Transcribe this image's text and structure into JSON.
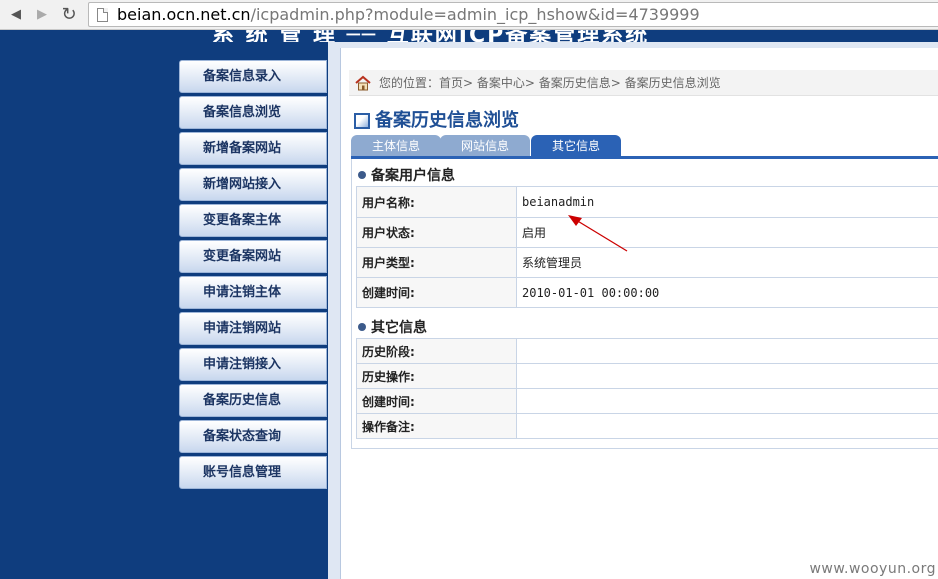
{
  "browser": {
    "url_host": "beian.ocn.net.cn",
    "url_path": "/icpadmin.php?module=admin_icp_hshow&id=4739999"
  },
  "header": {
    "title": "系 统 管 理 ── 互联网ICP备案管理系统"
  },
  "sidebar": {
    "items": [
      {
        "label": "备案信息录入"
      },
      {
        "label": "备案信息浏览"
      },
      {
        "label": "新增备案网站"
      },
      {
        "label": "新增网站接入"
      },
      {
        "label": "变更备案主体"
      },
      {
        "label": "变更备案网站"
      },
      {
        "label": "申请注销主体"
      },
      {
        "label": "申请注销网站"
      },
      {
        "label": "申请注销接入"
      },
      {
        "label": "备案历史信息"
      },
      {
        "label": "备案状态查询"
      },
      {
        "label": "账号信息管理"
      }
    ]
  },
  "breadcrumb": {
    "text": "您的位置：首页> 备案中心> 备案历史信息> 备案历史信息浏览"
  },
  "page": {
    "title": "备案历史信息浏览"
  },
  "tabs": [
    {
      "label": "主体信息"
    },
    {
      "label": "网站信息"
    },
    {
      "label": "其它信息"
    }
  ],
  "user_section": {
    "title": "备案用户信息",
    "rows": [
      {
        "label": "用户名称:",
        "value": "beianadmin"
      },
      {
        "label": "用户状态:",
        "value": "启用"
      },
      {
        "label": "用户类型:",
        "value": "系统管理员"
      },
      {
        "label": "创建时间:",
        "value": "2010-01-01 00:00:00"
      }
    ]
  },
  "other_section": {
    "title": "其它信息",
    "rows": [
      {
        "label": "历史阶段:",
        "value": ""
      },
      {
        "label": "历史操作:",
        "value": ""
      },
      {
        "label": "创建时间:",
        "value": ""
      },
      {
        "label": "操作备注:",
        "value": ""
      }
    ]
  },
  "watermark": "www.wooyun.org",
  "colors": {
    "sidebar_bg": "#0f3d7e",
    "tab_active": "#2b62b5",
    "tab_inactive": "#8eaad0",
    "title": "#1f4f95",
    "status_green": "#0a7a00",
    "annotation_arrow": "#cc0000"
  }
}
